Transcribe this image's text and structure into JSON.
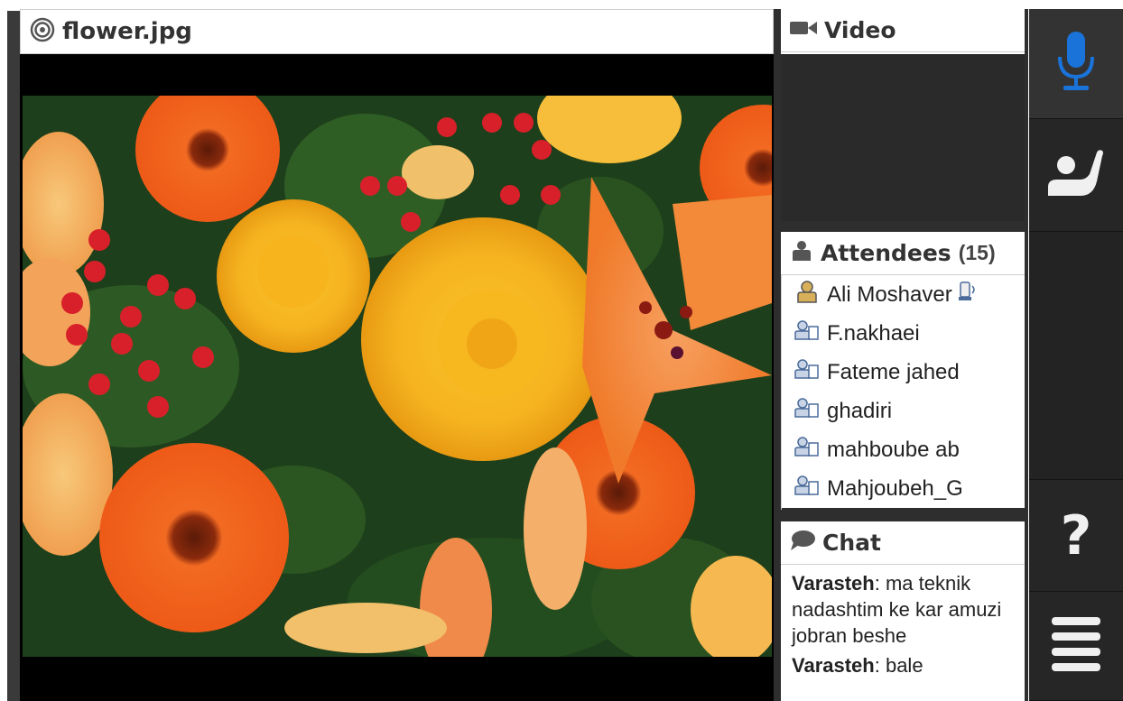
{
  "presentation": {
    "file_name": "flower.jpg",
    "file_icon": "target-icon"
  },
  "video": {
    "title": "Video",
    "icon": "camera-icon"
  },
  "attendees": {
    "title": "Attendees",
    "count": "(15)",
    "icon": "person-icon",
    "items": [
      {
        "name": "Ali Moshaver",
        "role": "presenter"
      },
      {
        "name": "F.nakhaei",
        "role": "attendee"
      },
      {
        "name": "Fateme jahed",
        "role": "attendee"
      },
      {
        "name": "ghadiri",
        "role": "attendee"
      },
      {
        "name": "mahboube ab",
        "role": "attendee"
      },
      {
        "name": "Mahjoubeh_G",
        "role": "attendee"
      }
    ]
  },
  "chat": {
    "title": "Chat",
    "icon": "speech-bubble-icon",
    "messages": [
      {
        "sender": "Varasteh",
        "text": ": ma teknik nadashtim ke kar amuzi jobran beshe"
      },
      {
        "sender": "Varasteh",
        "text": ": bale"
      }
    ]
  },
  "toolbar": {
    "items": [
      "microphone-icon",
      "raise-hand-icon",
      "help-icon",
      "menu-icon"
    ],
    "help_label": "?"
  },
  "colors": {
    "accent_blue": "#1a73d9",
    "panel_dark": "#2e2e2e",
    "sidebar_dark": "#1f1f1f"
  }
}
